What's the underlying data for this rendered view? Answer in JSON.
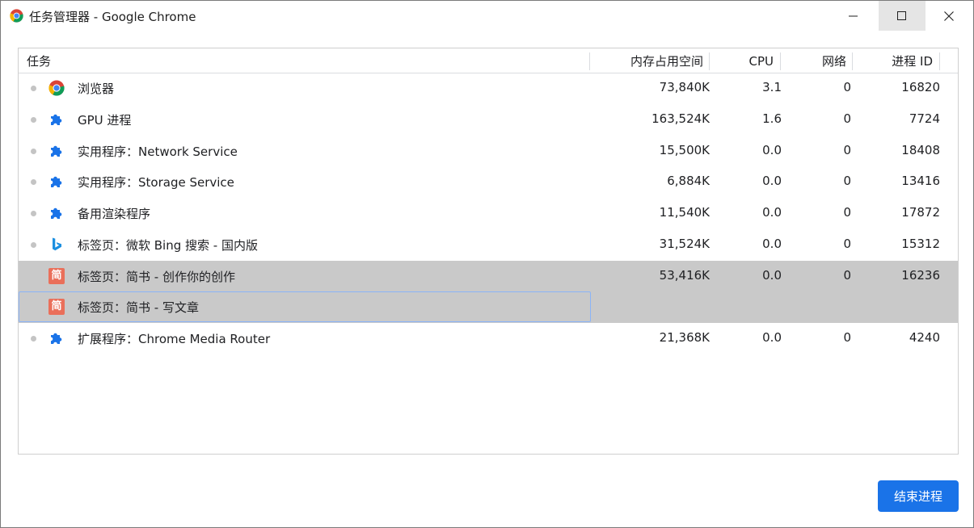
{
  "window": {
    "title": "任务管理器 - Google Chrome",
    "accent_color": "#1a73e8"
  },
  "table": {
    "headers": {
      "task": "任务",
      "memory": "内存占用空间",
      "cpu": "CPU",
      "network": "网络",
      "pid": "进程 ID"
    },
    "rows": [
      {
        "icon": "chrome-icon",
        "name": "浏览器",
        "memory": "73,840K",
        "cpu": "3.1",
        "network": "0",
        "pid": "16820"
      },
      {
        "icon": "puzzle-icon",
        "name": "GPU 进程",
        "memory": "163,524K",
        "cpu": "1.6",
        "network": "0",
        "pid": "7724"
      },
      {
        "icon": "puzzle-icon",
        "name": "实用程序：Network Service",
        "memory": "15,500K",
        "cpu": "0.0",
        "network": "0",
        "pid": "18408"
      },
      {
        "icon": "puzzle-icon",
        "name": "实用程序：Storage Service",
        "memory": "6,884K",
        "cpu": "0.0",
        "network": "0",
        "pid": "13416"
      },
      {
        "icon": "puzzle-icon",
        "name": "备用渲染程序",
        "memory": "11,540K",
        "cpu": "0.0",
        "network": "0",
        "pid": "17872"
      },
      {
        "icon": "bing-icon",
        "name": "标签页：微软 Bing 搜索 - 国内版",
        "memory": "31,524K",
        "cpu": "0.0",
        "network": "0",
        "pid": "15312"
      },
      {
        "icon": "jianshu-icon",
        "icon_text": "简",
        "name": "标签页：简书 - 创作你的创作",
        "memory": "53,416K",
        "cpu": "0.0",
        "network": "0",
        "pid": "16236",
        "selected": true
      },
      {
        "icon": "jianshu-icon",
        "icon_text": "简",
        "name": "标签页：简书 - 写文章",
        "memory": "",
        "cpu": "",
        "network": "",
        "pid": "",
        "selected": true,
        "focused": true
      },
      {
        "icon": "puzzle-icon",
        "name": "扩展程序：Chrome Media Router",
        "memory": "21,368K",
        "cpu": "0.0",
        "network": "0",
        "pid": "4240"
      }
    ]
  },
  "end_process_label": "结束进程"
}
